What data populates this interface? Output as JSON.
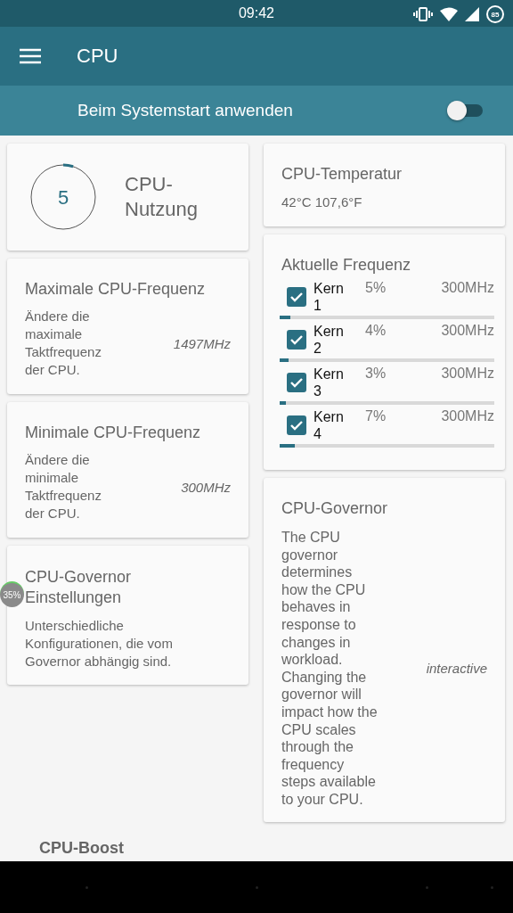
{
  "status_bar": {
    "time": "09:42",
    "battery": "85"
  },
  "app_bar": {
    "title": "CPU"
  },
  "apply_on_boot": {
    "label": "Beim Systemstart anwenden",
    "on": false
  },
  "cpu_usage": {
    "value": "5",
    "label": "CPU-Nutzung"
  },
  "max_freq": {
    "title": "Maximale CPU-Frequenz",
    "description": "Ändere die maximale Taktfrequenz der CPU.",
    "value": "1497MHz"
  },
  "min_freq": {
    "title": "Minimale CPU-Frequenz",
    "description": "Ändere die minimale Taktfrequenz der CPU.",
    "value": "300MHz"
  },
  "governor_settings": {
    "title": "CPU-Governor Einstellungen",
    "description": "Unterschiedliche Konfigurationen, die vom Governor abhängig sind."
  },
  "temperature": {
    "title": "CPU-Temperatur",
    "value": "42°C 107,6°F"
  },
  "current_freq": {
    "title": "Aktuelle Frequenz",
    "cores": [
      {
        "name": "Kern 1",
        "checked": true,
        "load": "5%",
        "freq": "300MHz",
        "level": 0.05
      },
      {
        "name": "Kern 2",
        "checked": true,
        "load": "4%",
        "freq": "300MHz",
        "level": 0.04
      },
      {
        "name": "Kern 3",
        "checked": true,
        "load": "3%",
        "freq": "300MHz",
        "level": 0.03
      },
      {
        "name": "Kern 4",
        "checked": true,
        "load": "7%",
        "freq": "300MHz",
        "level": 0.07
      }
    ]
  },
  "governor": {
    "title": "CPU-Governor",
    "description": "The CPU governor determines how the CPU behaves in response to changes in workload. Changing the governor will impact how the CPU scales through the frequency steps available to your CPU.",
    "value": "interactive"
  },
  "section_header": "CPU-Boost",
  "overlay_badge": "35%"
}
